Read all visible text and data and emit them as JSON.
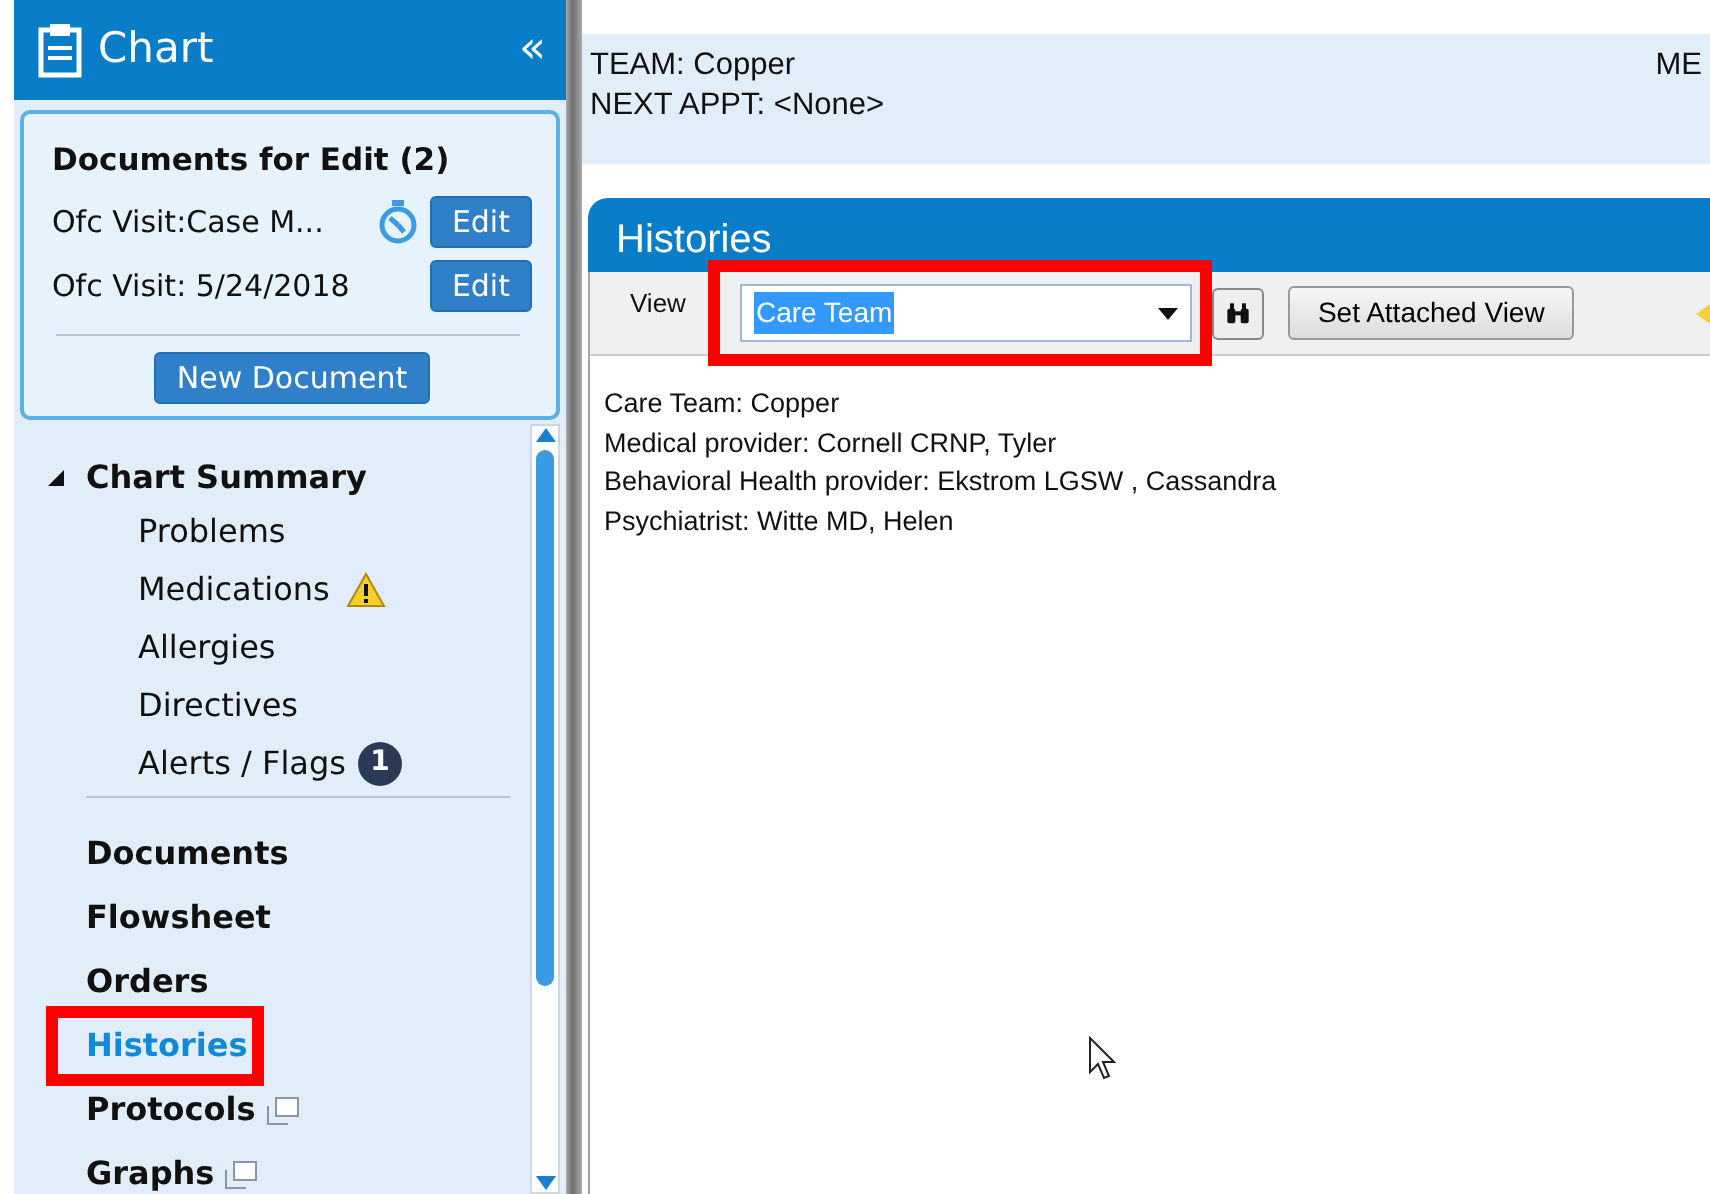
{
  "sidebar": {
    "title": "Chart",
    "collapse": "«",
    "documents_for_edit": {
      "title": "Documents for Edit (2)",
      "items": [
        {
          "label": "Ofc Visit:Case M...",
          "timer": true,
          "button": "Edit"
        },
        {
          "label": "Ofc Visit: 5/24/2018",
          "timer": false,
          "button": "Edit"
        }
      ],
      "new_button": "New Document"
    },
    "items": [
      {
        "label": "Chart Summary",
        "expanded": true,
        "selected": false,
        "highlighted": false,
        "popout": false,
        "children": [
          {
            "label": "Problems",
            "warning": false
          },
          {
            "label": "Medications",
            "warning": true
          },
          {
            "label": "Allergies",
            "warning": false
          },
          {
            "label": "Directives",
            "warning": false
          },
          {
            "label": "Alerts / Flags",
            "warning": false,
            "badge": "1"
          }
        ]
      },
      {
        "label": "Documents",
        "selected": false,
        "highlighted": false,
        "popout": false
      },
      {
        "label": "Flowsheet",
        "selected": false,
        "highlighted": false,
        "popout": false
      },
      {
        "label": "Orders",
        "selected": false,
        "highlighted": false,
        "popout": false
      },
      {
        "label": "Histories",
        "selected": true,
        "highlighted": true,
        "popout": false
      },
      {
        "label": "Protocols",
        "selected": false,
        "highlighted": false,
        "popout": true
      },
      {
        "label": "Graphs",
        "selected": false,
        "highlighted": false,
        "popout": true
      }
    ]
  },
  "banner": {
    "lines": [
      "TEAM: Copper",
      "NEXT APPT: <None>"
    ],
    "right_text": "ME"
  },
  "panel": {
    "title": "Histories",
    "view_label": "View",
    "view_value": "Care Team",
    "view_highlighted": true,
    "set_button": "Set Attached View",
    "lines": [
      "Care Team: Copper",
      "Medical provider: Cornell CRNP, Tyler",
      "Behavioral Health provider: Ekstrom LGSW , Cassandra",
      "Psychiatrist: Witte MD, Helen"
    ]
  }
}
